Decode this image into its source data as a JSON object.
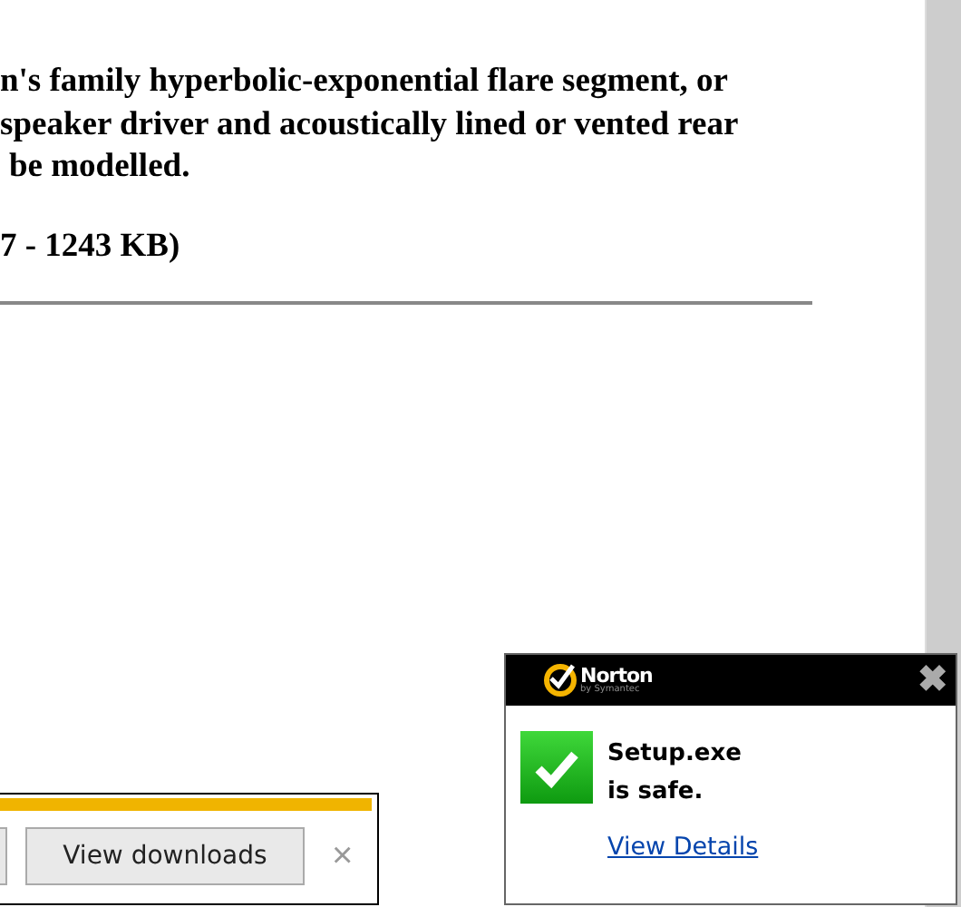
{
  "page": {
    "paragraph_lines": [
      "n's family hyperbolic-exponential flare segment, or",
      "speaker driver and acoustically lined or vented rear",
      "be modelled."
    ],
    "file_size": "7 - 1243 KB)"
  },
  "norton_popup": {
    "brand": "Norton",
    "brand_sub": "by Symantec",
    "close": "✖",
    "message_lines": [
      "Setup.exe",
      "is safe."
    ],
    "link": "View Details"
  },
  "download_bar": {
    "button": "View downloads",
    "close": "×"
  }
}
